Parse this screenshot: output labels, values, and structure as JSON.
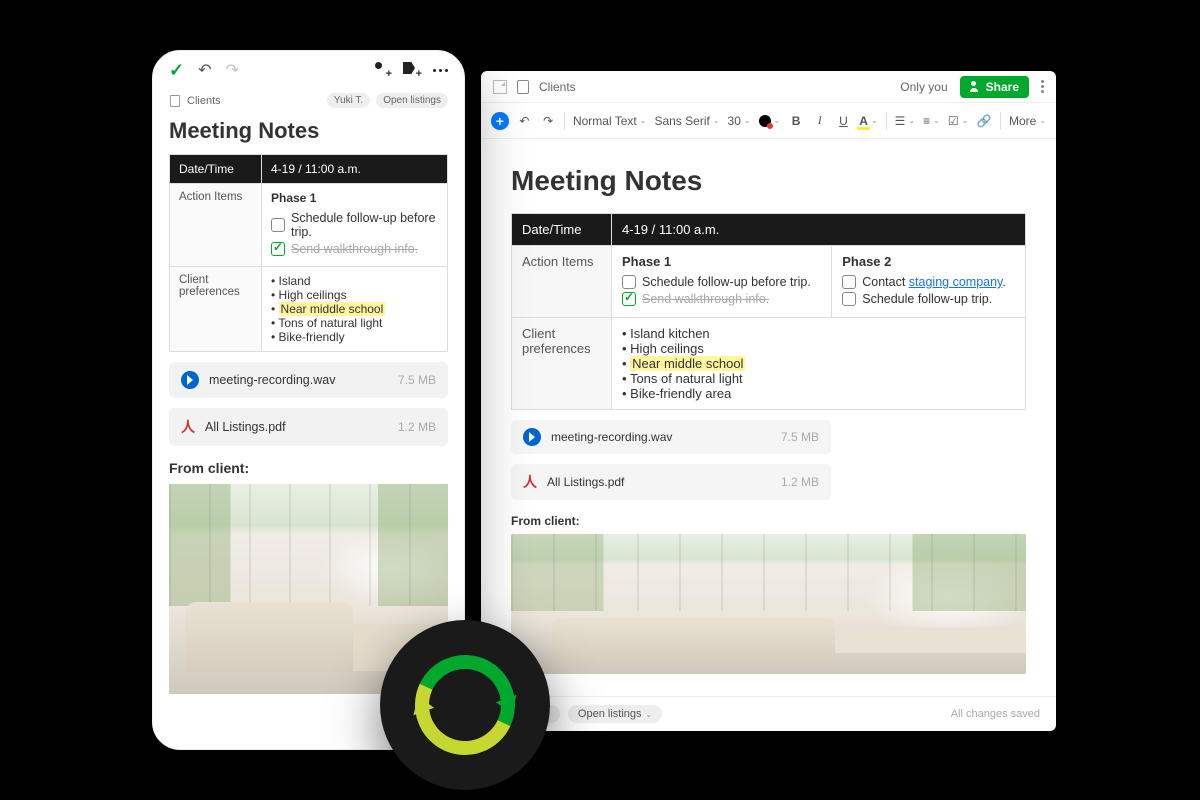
{
  "shared": {
    "notebook": "Clients",
    "note_title": "Meeting Notes",
    "table": {
      "header_datetime": "Date/Time",
      "datetime_value": "4-19 / 11:00 a.m.",
      "header_actions": "Action Items",
      "header_prefs": "Client preferences"
    },
    "phase1": {
      "title": "Phase 1",
      "item1": "Schedule follow-up before trip.",
      "item2": "Send walkthrough info."
    },
    "phase2": {
      "title": "Phase 2",
      "item1_pre": "Contact ",
      "item1_link": "staging company",
      "item1_post": ".",
      "item2": "Schedule follow-up trip."
    },
    "attachments": {
      "audio_name": "meeting-recording.wav",
      "audio_size": "7.5 MB",
      "pdf_name": "All Listings.pdf",
      "pdf_size": "1.2 MB"
    },
    "from_client": "From client:",
    "tags": {
      "t1": "Yuki T.",
      "t2": "Open listings"
    }
  },
  "desktop": {
    "only_you": "Only you",
    "share": "Share",
    "toolbar": {
      "style": "Normal Text",
      "font": "Sans Serif",
      "size": "30",
      "more": "More"
    },
    "prefs": {
      "p1": "Island kitchen",
      "p2": "High ceilings",
      "p3": "Near middle school",
      "p4": "Tons of natural light",
      "p5": "Bike-friendly area"
    },
    "saved": "All changes saved"
  },
  "mobile": {
    "prefs": {
      "p1": "Island",
      "p2": "High ceilings",
      "p3": "Near middle school",
      "p4": "Tons of natural light",
      "p5": "Bike-friendly"
    }
  }
}
